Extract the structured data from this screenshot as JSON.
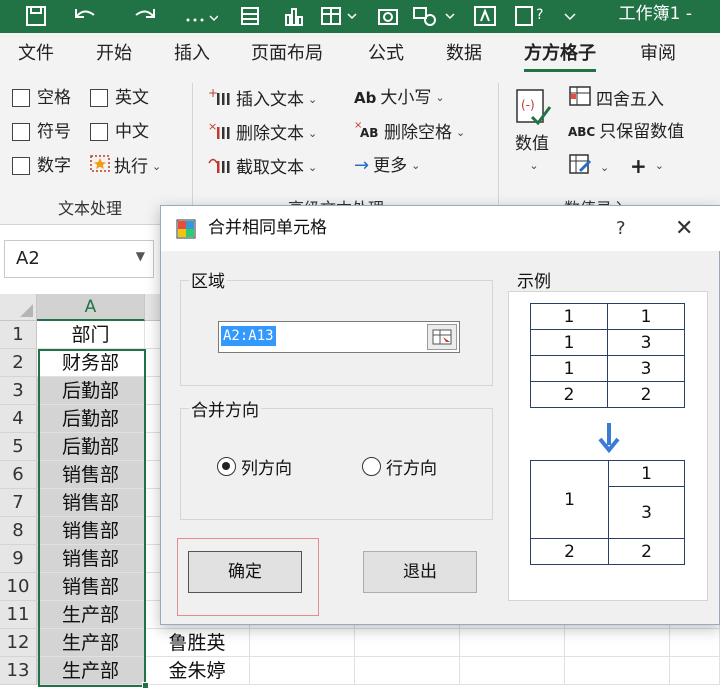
{
  "titlebar": {
    "doc_title": "工作簿1 -"
  },
  "tabs": [
    "文件",
    "开始",
    "插入",
    "页面布局",
    "公式",
    "数据",
    "方方格子",
    "审阅"
  ],
  "active_tab": "方方格子",
  "ribbon": {
    "text_group": {
      "checkboxes": [
        "空格",
        "英文",
        "符号",
        "中文",
        "数字"
      ],
      "execute": "执行",
      "label": "文本处理"
    },
    "advanced_group": {
      "insert_text": "插入文本",
      "delete_text": "删除文本",
      "extract_text": "截取文本",
      "case": "大小写",
      "delete_space": "删除空格",
      "more": "更多",
      "label": "高级文本处理"
    },
    "numeric_group": {
      "numeric": "数值",
      "round": "四舍五入",
      "keep_numbers": "只保留数值",
      "label": "数值录入"
    }
  },
  "namebox": {
    "value": "A2"
  },
  "sheet": {
    "column_a": "A",
    "rows": [
      "1",
      "2",
      "3",
      "4",
      "5",
      "6",
      "7",
      "8",
      "9",
      "10",
      "11",
      "12",
      "13"
    ],
    "col_a_values": [
      "部门",
      "财务部",
      "后勤部",
      "后勤部",
      "后勤部",
      "销售部",
      "销售部",
      "销售部",
      "销售部",
      "销售部",
      "生产部",
      "生产部",
      "生产部"
    ],
    "col_b_values": [
      "",
      "",
      "",
      "",
      "",
      "",
      "",
      "",
      "",
      "",
      "",
      "鲁胜英",
      "金朱婷"
    ]
  },
  "dialog": {
    "title": "合并相同单元格",
    "help": "?",
    "close": "✕",
    "region_label": "区域",
    "range_value": "A2:A13",
    "direction_label": "合并方向",
    "radio_col": "列方向",
    "radio_row": "行方向",
    "selected_direction": "列方向",
    "ok": "确定",
    "exit": "退出",
    "example_label": "示例",
    "example_before": [
      [
        "1",
        "1"
      ],
      [
        "1",
        "3"
      ],
      [
        "1",
        "3"
      ],
      [
        "2",
        "2"
      ]
    ],
    "example_after": {
      "merged_a": "1",
      "b1": "1",
      "b2": "3",
      "a_last": "2",
      "b_last": "2"
    }
  },
  "colors": {
    "excel_green": "#217346",
    "selection_blue": "#3399ff",
    "example_border": "#2a3e66",
    "arrow_blue": "#3a7bd5",
    "highlight_red": "#e58d8d"
  }
}
